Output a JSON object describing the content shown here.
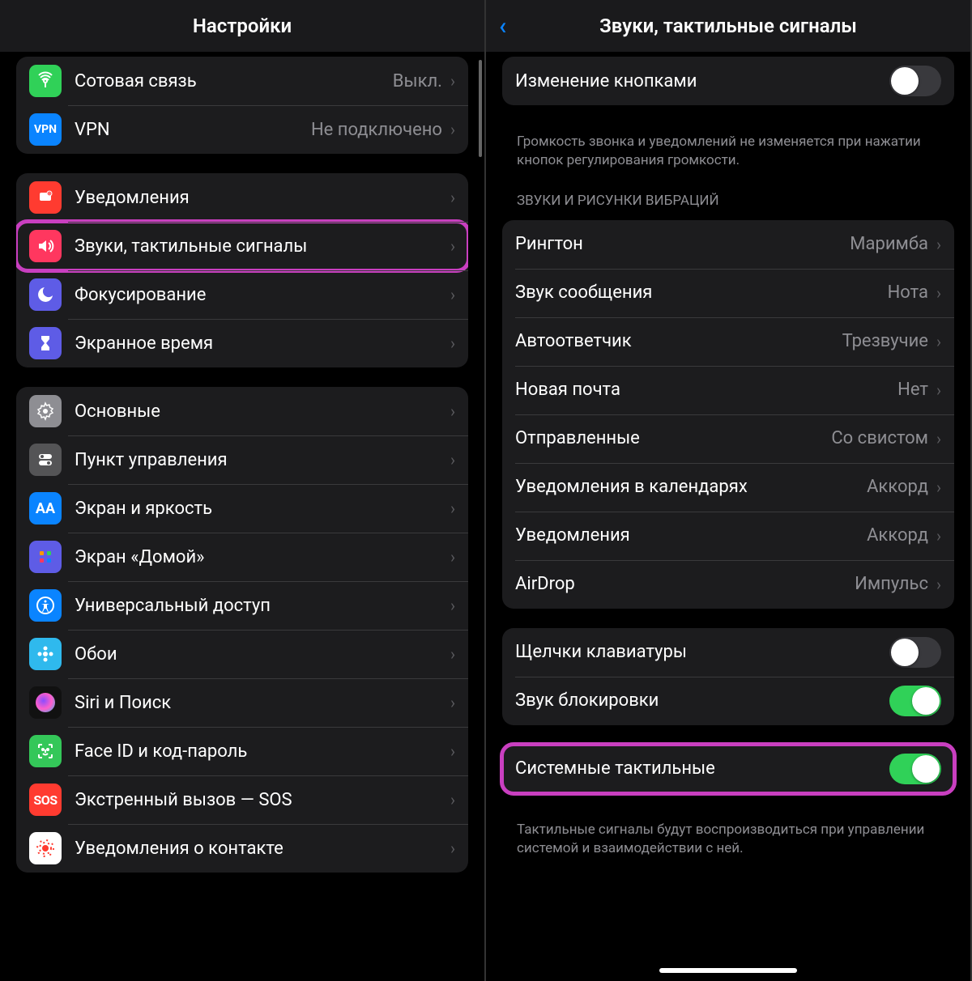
{
  "left": {
    "title": "Настройки",
    "group1": [
      {
        "icon": "antenna-icon",
        "bg": "bg-green",
        "label": "Сотовая связь",
        "value": "Выкл."
      },
      {
        "icon": "vpn-icon",
        "bg": "bg-blue",
        "label": "VPN",
        "value": "Не подключено"
      }
    ],
    "group2": [
      {
        "icon": "bell-icon",
        "bg": "bg-red",
        "label": "Уведомления"
      },
      {
        "icon": "speaker-icon",
        "bg": "bg-pink",
        "label": "Звуки, тактильные сигналы",
        "highlight": true
      },
      {
        "icon": "moon-icon",
        "bg": "bg-indigo",
        "label": "Фокусирование"
      },
      {
        "icon": "hourglass-icon",
        "bg": "bg-indigo",
        "label": "Экранное время"
      }
    ],
    "group3": [
      {
        "icon": "gear-icon",
        "bg": "bg-gray",
        "label": "Основные"
      },
      {
        "icon": "switches-icon",
        "bg": "bg-dgray",
        "label": "Пункт управления"
      },
      {
        "icon": "aa-icon",
        "bg": "bg-blue",
        "label": "Экран и яркость"
      },
      {
        "icon": "grid-icon",
        "bg": "bg-indigo",
        "label": "Экран «Домой»"
      },
      {
        "icon": "accessibility-icon",
        "bg": "bg-blue",
        "label": "Универсальный доступ"
      },
      {
        "icon": "flower-icon",
        "bg": "bg-cyan",
        "label": "Обои"
      },
      {
        "icon": "siri-icon",
        "bg": "bg-siri",
        "label": "Siri и Поиск"
      },
      {
        "icon": "faceid-icon",
        "bg": "bg-green2",
        "label": "Face ID и код-пароль"
      },
      {
        "icon": "sos-icon",
        "bg": "bg-sosred",
        "label": "Экстренный вызов — SOS"
      },
      {
        "icon": "exposure-icon",
        "bg": "bg-red",
        "label": "Уведомления о контакте"
      }
    ]
  },
  "right": {
    "title": "Звуки, тактильные сигналы",
    "top_row": {
      "label": "Изменение кнопками"
    },
    "top_footer": "Громкость звонка и уведомлений не изменяется при нажатии кнопок регулирования громкости.",
    "section_header": "ЗВУКИ И РИСУНКИ ВИБРАЦИЙ",
    "sounds": [
      {
        "label": "Рингтон",
        "value": "Маримба"
      },
      {
        "label": "Звук сообщения",
        "value": "Нота"
      },
      {
        "label": "Автоответчик",
        "value": "Трезвучие"
      },
      {
        "label": "Новая почта",
        "value": "Нет"
      },
      {
        "label": "Отправленные",
        "value": "Со свистом"
      },
      {
        "label": "Уведомления в календарях",
        "value": "Аккорд"
      },
      {
        "label": "Уведомления",
        "value": "Аккорд"
      },
      {
        "label": "AirDrop",
        "value": "Импульс"
      }
    ],
    "group2": [
      {
        "label": "Щелчки клавиатуры",
        "on": false
      },
      {
        "label": "Звук блокировки",
        "on": true
      }
    ],
    "group3": {
      "label": "Системные тактильные",
      "on": true
    },
    "footer3": "Тактильные сигналы будут воспроизводиться при управлении системой и взаимодействии с ней."
  }
}
